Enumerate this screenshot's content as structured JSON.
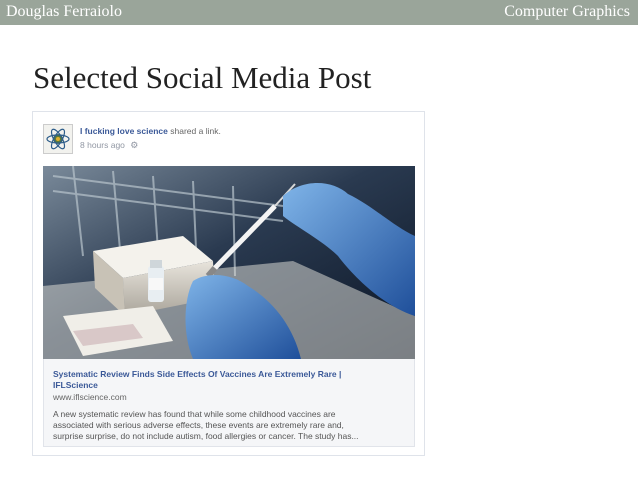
{
  "header": {
    "author": "Douglas Ferraiolo",
    "course": "Computer Graphics"
  },
  "slide": {
    "title": "Selected Social Media Post"
  },
  "post": {
    "page_name": "I fucking love science",
    "action": "shared a link.",
    "time": "8 hours ago",
    "time_icon": "gear-icon",
    "link": {
      "title_line1": "Systematic Review Finds Side Effects Of Vaccines Are Extremely Rare |",
      "title_line2": "IFLScience",
      "domain": "www.iflscience.com",
      "desc_line1": "A new systematic review has found that while some childhood vaccines are",
      "desc_line2": "associated with serious adverse effects, these events are extremely rare and,",
      "desc_line3": "surprise surprise, do not include autism, food allergies or cancer. The study has..."
    }
  },
  "colors": {
    "header_bar": "#9aa59a",
    "link_blue": "#3b5998",
    "glove_blue": "#3a74c2"
  }
}
